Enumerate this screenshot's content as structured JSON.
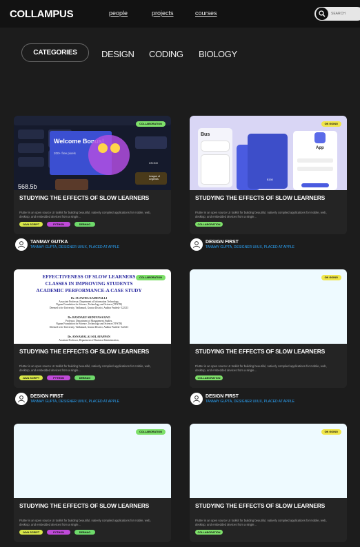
{
  "header": {
    "logo": "COLLAMPUS",
    "nav": [
      "people",
      "projects",
      "courses"
    ],
    "search_placeholder": "SEARCH"
  },
  "categories": {
    "pill_label": "CATEGORIES",
    "tabs": [
      "DESIGN",
      "CODING",
      "BIOLOGY"
    ]
  },
  "colors": {
    "badge_collaboration": "#7ee06a",
    "badge_ongoing": "#f0e64a",
    "tag_java": "#d9e84a",
    "tag_python": "#c04ad9",
    "tag_debhag": "#6ed96a",
    "author_role": "#2ba8ff"
  },
  "cards": [
    {
      "badge": "COLLABORATION",
      "title": "STUDYING THE EFFECTS OF SLOW LEARNERS",
      "description": "Flutter is an open source UI toolkit for building beautiful, natively compiled applications for mobile, web, desktop, and embedded devices from a single...",
      "tags": [
        "JAVA SCRIPT",
        "PYTHON",
        "DEBHAG"
      ],
      "author": "TANMAY GUTKA",
      "role": "TANMAY GUPTA, DESIGNER UI/UX, PLACED AT APPLE",
      "thumb": {
        "type": "game-dashboard",
        "banner_title": "Welcome Bonus!",
        "banner_sub": "200+ free pixels",
        "stat": "568.5b",
        "side_label": "League of Legends",
        "side_value": "CS:GO"
      }
    },
    {
      "badge": "ON GOING",
      "title": "STUDYING THE EFFECTS OF SLOW LEARNERS",
      "description": "Flutter is an open source UI toolkit for building beautiful, natively compiled applications for mobile, web, desktop, and embedded devices from a single...",
      "tags": [
        "COLLABORATION"
      ],
      "author": "DESIGN FIRST",
      "role": "TANMAY GUPTA, DESIGNER UI/UX, PLACED AT APPLE",
      "thumb": {
        "type": "mobile-app",
        "screen1_title": "Bus",
        "screen3_title": "App",
        "price": "$150"
      }
    },
    {
      "badge": "COLLABORATION",
      "title": "STUDYING THE EFFECTS OF SLOW LEARNERS",
      "description": "Flutter is an open source UI toolkit for building beautiful, natively compiled applications for mobile, web, desktop, and embedded devices from a single...",
      "tags": [
        "JAVA SCRIPT",
        "PYTHON",
        "DEBHAG"
      ],
      "author": "DESIGN FIRST",
      "role": "TANMAY GUPTA, DESIGNER UI/UX, PLACED AT APPLE",
      "thumb": {
        "type": "paper",
        "title_lines": [
          "EFFECTIVENESS OF SLOW LEARNERS",
          "CLASSES IN IMPROVING STUDENTS",
          "ACADEMIC PERFORMANCE-A CASE STUDY"
        ],
        "authors": [
          {
            "name": "Dr. SUJATHA KAMEPALLI",
            "lines": [
              "Associate Professor, Department of Information Technology,",
              "Vignan Foundation for Science, Technology and Science (VFSTR)",
              "Deemed to be University, Vadlamudi, Guntur District, Andhra Pradesh- 522213"
            ]
          },
          {
            "name": "Dr. BANDARU SRINIVASA RAO",
            "lines": [
              "Professor, Department of Management Studies,",
              "Vignan Foundation for Science, Technology and Science (VFSTR)",
              "Deemed to be University, Vadlamudi, Guntur District, Andhra Pradesh- 522213"
            ]
          },
          {
            "name": "Dr. ANNAMALAI SOLAYAPPAN",
            "lines": [
              "Assistant Professor, Department of Business Administration,"
            ]
          }
        ]
      }
    },
    {
      "badge": "ON GOING",
      "title": "STUDYING THE EFFECTS OF SLOW LEARNERS",
      "description": "Flutter is an open source UI toolkit for building beautiful, natively compiled applications for mobile, web, desktop, and embedded devices from a single...",
      "tags": [
        "COLLABORATION"
      ],
      "author": "DESIGN FIRST",
      "role": "TANMAY GUPTA, DESIGNER UI/UX, PLACED AT APPLE",
      "thumb": {
        "type": "blank"
      }
    },
    {
      "badge": "COLLABORATION",
      "title": "STUDYING THE EFFECTS OF SLOW LEARNERS",
      "description": "Flutter is an open source UI toolkit for building beautiful, natively compiled applications for mobile, web, desktop, and embedded devices from a single...",
      "tags": [
        "JAVA SCRIPT",
        "PYTHON",
        "DEBHAG"
      ],
      "author": "",
      "role": "",
      "thumb": {
        "type": "blank"
      }
    },
    {
      "badge": "ON GOING",
      "title": "STUDYING THE EFFECTS OF SLOW LEARNERS",
      "description": "Flutter is an open source UI toolkit for building beautiful, natively compiled applications for mobile, web, desktop, and embedded devices from a single...",
      "tags": [
        "COLLABORATION"
      ],
      "author": "",
      "role": "",
      "thumb": {
        "type": "blank"
      }
    }
  ]
}
